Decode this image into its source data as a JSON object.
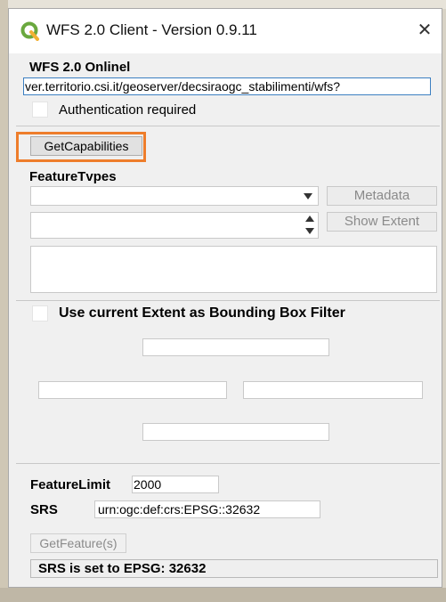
{
  "window": {
    "title": "WFS 2.0 Client - Version 0.9.11",
    "close_glyph": "✕",
    "logo_icon": "qgis-logo-icon"
  },
  "wfs_online": {
    "label": "WFS 2.0 Onlinel",
    "url_value": "ver.territorio.csi.it/geoserver/decsiraogc_stabilimenti/wfs?",
    "auth_label": "Authentication required",
    "auth_checked": false
  },
  "getcapabilities": {
    "label": "GetCapabilities",
    "highlight_color": "#ee7d2b"
  },
  "featuretypes": {
    "label": "FeatureTvpes",
    "dropdown_value": "",
    "metadata_label": "Metadata",
    "spinbox_value": "",
    "show_extent_label": "Show Extent",
    "textarea_value": ""
  },
  "bbox": {
    "checkbox_label": "Use current Extent as Bounding Box Filter",
    "checked": false,
    "north": "",
    "west": "",
    "east": "",
    "south": ""
  },
  "feature_limit": {
    "label": "FeatureLimit",
    "value": "2000"
  },
  "srs": {
    "label": "SRS",
    "value": "urn:ogc:def:crs:EPSG::32632"
  },
  "getfeature": {
    "label": "GetFeature(s)",
    "enabled": false
  },
  "status": {
    "text": "SRS is set to EPSG: 32632"
  }
}
